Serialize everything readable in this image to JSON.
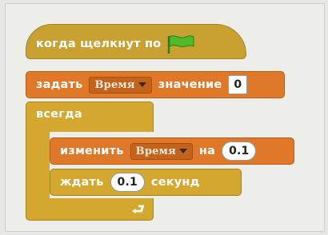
{
  "hat": {
    "label": "когда щелкнут по",
    "icon": "green-flag-icon"
  },
  "set_block": {
    "label_before": "задать",
    "variable": "Время",
    "label_after": "значение",
    "value": "0"
  },
  "forever_block": {
    "label": "всегда",
    "icon": "loop-arrow-icon"
  },
  "change_block": {
    "label_before": "изменить",
    "variable": "Время",
    "label_after": "на",
    "value": "0.1"
  },
  "wait_block": {
    "label_before": "ждать",
    "value": "0.1",
    "label_after": "секунд"
  },
  "colors": {
    "events": "#c9a132",
    "variables": "#e0782a",
    "control": "#d4a82e",
    "flag": "#4fb92a"
  }
}
